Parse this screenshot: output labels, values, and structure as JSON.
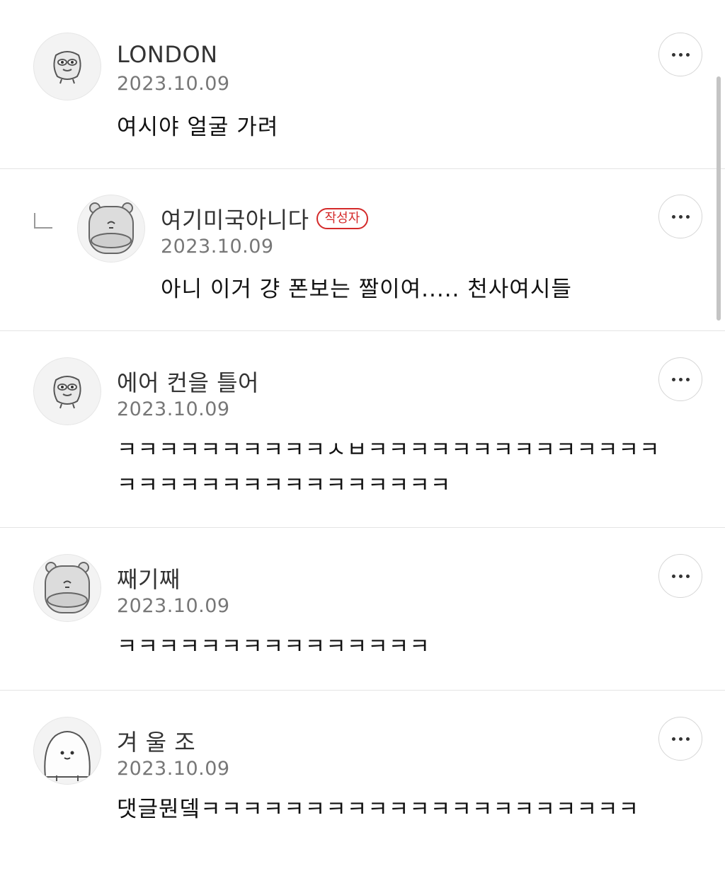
{
  "comments": [
    {
      "author": "LONDON",
      "date": "2023.10.09",
      "body": "여시야 얼굴 가려",
      "avatar": "frog-face-icon"
    },
    {
      "author": "여기미국아니다",
      "badge": "작성자",
      "date": "2023.10.09",
      "body": "아니 이거 걍 폰보는 짤이여..... 천사여시들",
      "avatar": "bear-icon",
      "is_reply": true
    },
    {
      "author": "에어 컨을 틀어",
      "date": "2023.10.09",
      "body": "ㅋㅋㅋㅋㅋㅋㅋㅋㅋㅋㅅㅂㅋㅋㅋㅋㅋㅋㅋㅋㅋㅋㅋㅋㅋㅋㅋㅋㅋㅋㅋㅋㅋㅋㅋㅋㅋㅋㅋㅋㅋㅋ",
      "avatar": "frog-face-icon"
    },
    {
      "author": "째기째",
      "date": "2023.10.09",
      "body": "ㅋㅋㅋㅋㅋㅋㅋㅋㅋㅋㅋㅋㅋㅋㅋ",
      "avatar": "bear-icon"
    },
    {
      "author": "겨 울 조",
      "date": "2023.10.09",
      "body": "댓글뭔뎈ㅋㅋㅋㅋㅋㅋㅋㅋㅋㅋㅋㅋㅋㅋㅋㅋㅋㅋㅋㅋㅋ",
      "avatar": "round-face-icon"
    }
  ],
  "colors": {
    "badge": "#d42a2a",
    "divider": "#e4e4e4",
    "date": "#777777"
  }
}
